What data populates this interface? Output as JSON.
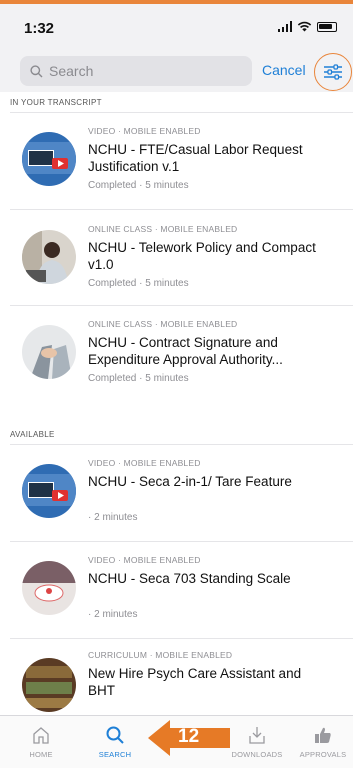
{
  "status": {
    "time": "1:32"
  },
  "search": {
    "placeholder": "Search",
    "cancel_label": "Cancel"
  },
  "sections": {
    "transcript_label": "IN YOUR TRANSCRIPT",
    "available_label": "AVAILABLE"
  },
  "transcript_items": [
    {
      "meta": "VIDEO · MOBILE ENABLED",
      "title": "NCHU - FTE/Casual Labor Request Justification v.1",
      "sub": "Completed · 5 minutes",
      "thumb": "video-tutorials-thumbnail"
    },
    {
      "meta": "ONLINE CLASS · MOBILE ENABLED",
      "title": "NCHU - Telework Policy and Compact v1.0",
      "sub": "Completed · 5 minutes",
      "thumb": "person-at-laptop-thumbnail"
    },
    {
      "meta": "ONLINE CLASS · MOBILE ENABLED",
      "title": "NCHU - Contract Signature and Expenditure Approval Authority...",
      "sub": "Completed · 5 minutes",
      "thumb": "handshake-thumbnail"
    }
  ],
  "available_items": [
    {
      "meta": "VIDEO · MOBILE ENABLED",
      "title": "NCHU - Seca 2-in-1/ Tare Feature",
      "sub": "· 2 minutes",
      "thumb": "video-tutorials-thumbnail"
    },
    {
      "meta": "VIDEO · MOBILE ENABLED",
      "title": "NCHU - Seca 703 Standing Scale",
      "sub": "· 2 minutes",
      "thumb": "scale-thumbnail"
    },
    {
      "meta": "CURRICULUM · MOBILE ENABLED",
      "title": "New Hire Psych Care Assistant and BHT",
      "sub": "",
      "thumb": "bookshelf-thumbnail"
    }
  ],
  "tabs": [
    {
      "label": "HOME",
      "icon": "home-icon"
    },
    {
      "label": "SEARCH",
      "icon": "search-icon"
    },
    {
      "label": "",
      "icon": "list-icon"
    },
    {
      "label": "DOWNLOADS",
      "icon": "download-icon"
    },
    {
      "label": "APPROVALS",
      "icon": "thumbs-up-icon"
    }
  ],
  "annotation": {
    "step_number": "12"
  },
  "colors": {
    "accent": "#e9853a",
    "link": "#1e7fd6"
  }
}
